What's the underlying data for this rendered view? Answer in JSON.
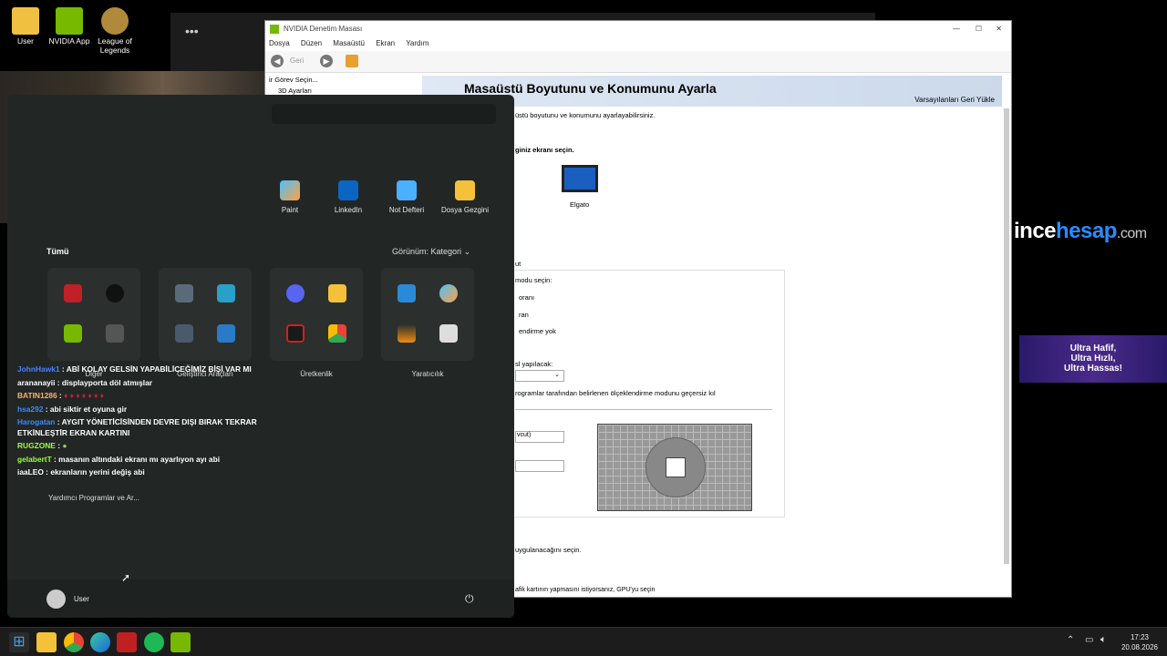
{
  "desktop": {
    "icons": [
      {
        "label": "User"
      },
      {
        "label": "NVIDIA App"
      },
      {
        "label": "League of Legends"
      }
    ]
  },
  "nvidia": {
    "title": "NVIDIA Denetim Masası",
    "menu": [
      "Dosya",
      "Düzen",
      "Masaüstü",
      "Ekran",
      "Yardım"
    ],
    "back_label": "Geri",
    "tree_items": [
      "ir Görev Seçin...",
      "3D Ayarları"
    ],
    "page_title": "Masaüstü Boyutunu ve Konumunu Ayarla",
    "restore": "Varsayılanları Geri Yükle",
    "desc": "üstü boyutunu ve konumunu ayarlayabilirsiniz.",
    "choose_display": "giniz ekranı seçin.",
    "display_name": "Elgato",
    "display_name_2": "...",
    "tab_partial": "ut",
    "mode_label": "modu seçin:",
    "opt1": "oranı",
    "opt2": "ran",
    "opt3": "endirme yok",
    "where_label": "sl yapılacak:",
    "override": "rogramlar tarafından belirlenen ölçeklendirme modunu geçersiz kıl",
    "dropdown1": "vcut)",
    "apply_label": "uygulanacağını seçin.",
    "gpu_text": "afik kartının yapmasını istiyorsanız, GPU'yu seçin"
  },
  "start": {
    "pinned": [
      {
        "label": "Paint"
      },
      {
        "label": "LinkedIn"
      },
      {
        "label": "Not Defteri"
      },
      {
        "label": "Dosya Gezgini"
      }
    ],
    "all_label": "Tümü",
    "view_label": "Görünüm: Kategori",
    "categories": [
      {
        "label": "Diğer"
      },
      {
        "label": "Geliştirici Araçları"
      },
      {
        "label": "Üretkenlik"
      },
      {
        "label": "Yaratıcılık"
      }
    ],
    "helpers": "Yardımcı Programlar ve Ar...",
    "user": "User"
  },
  "chat": [
    {
      "user": "JohnHawk1",
      "color": "#4f7fff",
      "msg": "ABİ KOLAY GELSİN YAPABİLİCEĞİMİZ BİŞİ VAR MI"
    },
    {
      "user": "arananayii",
      "color": "#ffffff",
      "msg": "displayporta döl atmışlar"
    },
    {
      "user": "BATIN1286",
      "color": "#ffb070",
      "msg": ""
    },
    {
      "user": "hsa292",
      "color": "#3a8cff",
      "msg": "abi siktir et oyuna gir"
    },
    {
      "user": "Harogatan",
      "color": "#3a8cff",
      "msg": "AYGIT YÖNETİCİSİNDEN DEVRE DIŞI BIRAK TEKRAR"
    },
    {
      "user": "",
      "color": "#ffffff",
      "msg": "ETKİNLEŞTİR EKRAN KARTINI"
    },
    {
      "user": "RUGZONE",
      "color": "#9cff3a",
      "msg": ""
    },
    {
      "user": "gelabertT",
      "color": "#9cff3a",
      "msg": "masanın altındaki ekranı mı ayarlıyon ayı abi"
    },
    {
      "user": "iaaLEO",
      "color": "#ffffff",
      "msg": "ekranların yerini değiş abi"
    }
  ],
  "ad": {
    "brand_a": "ince",
    "brand_b": "hesap",
    "brand_c": ".com",
    "banner": [
      "Ultra Hafif,",
      "Ultra Hızlı,",
      "Ultra Hassas!"
    ]
  },
  "taskbar": {
    "time": "17:23",
    "date": "20.08.2026"
  },
  "colors": {
    "accent": "#1a4aa0",
    "nvgreen": "#76b900",
    "startbg": "#222725"
  }
}
